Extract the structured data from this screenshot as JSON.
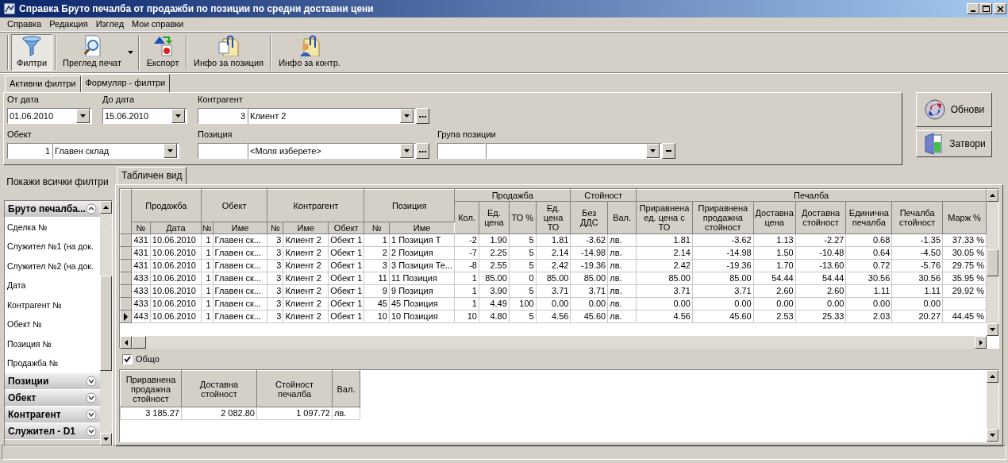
{
  "window": {
    "title": "Справка Бруто печалба от продажби по позиции по средни доставни цени"
  },
  "menu": [
    "Справка",
    "Редакция",
    "Изглед",
    "Мои справки"
  ],
  "toolbar": [
    {
      "label": "Филтри",
      "pressed": true,
      "has_dropdown": false
    },
    {
      "label": "Преглед печат",
      "pressed": false,
      "has_dropdown": true
    },
    {
      "label": "Експорт",
      "pressed": false,
      "has_dropdown": false
    },
    {
      "label": "Инфо за позиция",
      "pressed": false,
      "has_dropdown": false
    },
    {
      "label": "Инфо за контр.",
      "pressed": false,
      "has_dropdown": false
    }
  ],
  "filter_tabs": [
    {
      "label": "Активни филтри",
      "selected": false
    },
    {
      "label": "Формуляр - филтри",
      "selected": true
    }
  ],
  "filter_rows": [
    [
      {
        "kind": "date",
        "label": "От дата",
        "value": "01.06.2010"
      },
      {
        "kind": "date",
        "label": "До дата",
        "value": "15.06.2010"
      },
      {
        "kind": "lookup",
        "label": "Контрагент",
        "code": "3",
        "value": "Клиент 2"
      }
    ],
    [
      {
        "kind": "list",
        "label": "Обект",
        "code": "1",
        "value": "Главен склад"
      },
      {
        "kind": "lookup",
        "label": "Позиция",
        "value": "<Моля изберете>"
      },
      {
        "kind": "group",
        "label": "Група позиции"
      }
    ]
  ],
  "side_buttons": [
    "Обнови",
    "Затвори"
  ],
  "sidebar": {
    "show_all": "Покажи всички филтри",
    "groups": [
      {
        "title": "Бруто печалба...",
        "expanded": true,
        "items": [
          "Сделка №",
          "Служител №1 (на док.",
          "Служител №2 (на док.",
          "Дата",
          "Контрагент №",
          "Обект №",
          "Позиция №",
          "Продажба №"
        ]
      },
      {
        "title": "Позиции",
        "expanded": false
      },
      {
        "title": "Обект",
        "expanded": false
      },
      {
        "title": "Контрагент",
        "expanded": false
      },
      {
        "title": "Служител - D1",
        "expanded": false
      }
    ]
  },
  "grid": {
    "tab": "Табличен вид",
    "groups": [
      {
        "title": "Продажба",
        "kind": "spanning",
        "columns": [
          "№",
          "Дата"
        ]
      },
      {
        "title": "Обект",
        "kind": "spanning",
        "columns": [
          "№",
          "Име"
        ]
      },
      {
        "title": "Контрагент",
        "kind": "spanning",
        "columns": [
          "№",
          "Име",
          "Обект"
        ]
      },
      {
        "title": "Позиция",
        "kind": "spanning",
        "columns": [
          "№",
          "Име"
        ]
      },
      {
        "title": "Продажба",
        "kind": "banner",
        "columns": [
          "Кол.",
          "Ед. цена",
          "ТО %",
          "Ед. цена ТО"
        ]
      },
      {
        "title": "Стойност",
        "kind": "banner",
        "columns": [
          "Без ДДС",
          "Вал."
        ]
      },
      {
        "title": "Печалба",
        "kind": "banner",
        "columns": [
          "Приравнена ед. цена с ТО",
          "Приравнена продажна стойност",
          "Доставна цена",
          "Доставна стойност",
          "Единична печалба",
          "Печалба стойност",
          "Марж %"
        ]
      }
    ],
    "rows": [
      {
        "current": false,
        "cells": [
          "431",
          "10.06.2010",
          "1",
          "Главен ск...",
          "3",
          "Клиент 2",
          "Обект 1",
          "1",
          "1 Позиция Т",
          "-2",
          "1.90",
          "5",
          "1.81",
          "-3.62",
          "лв.",
          "1.81",
          "-3.62",
          "1.13",
          "-2.27",
          "0.68",
          "-1.35",
          "37.33 %"
        ]
      },
      {
        "current": false,
        "cells": [
          "431",
          "10.06.2010",
          "1",
          "Главен ск...",
          "3",
          "Клиент 2",
          "Обект 1",
          "2",
          "2 Позиция",
          "-7",
          "2.25",
          "5",
          "2.14",
          "-14.98",
          "лв.",
          "2.14",
          "-14.98",
          "1.50",
          "-10.48",
          "0.64",
          "-4.50",
          "30.05 %"
        ]
      },
      {
        "current": false,
        "cells": [
          "431",
          "10.06.2010",
          "1",
          "Главен ск...",
          "3",
          "Клиент 2",
          "Обект 1",
          "3",
          "3 Позиция Те...",
          "-8",
          "2.55",
          "5",
          "2.42",
          "-19.36",
          "лв.",
          "2.42",
          "-19.36",
          "1.70",
          "-13.60",
          "0.72",
          "-5.76",
          "29.75 %"
        ]
      },
      {
        "current": false,
        "cells": [
          "433",
          "10.06.2010",
          "1",
          "Главен ск...",
          "3",
          "Клиент 2",
          "Обект 1",
          "11",
          "11 Позиция",
          "1",
          "85.00",
          "0",
          "85.00",
          "85.00",
          "лв.",
          "85.00",
          "85.00",
          "54.44",
          "54.44",
          "30.56",
          "30.56",
          "35.95 %"
        ]
      },
      {
        "current": false,
        "cells": [
          "433",
          "10.06.2010",
          "1",
          "Главен ск...",
          "3",
          "Клиент 2",
          "Обект 1",
          "9",
          "9 Позиция",
          "1",
          "3.90",
          "5",
          "3.71",
          "3.71",
          "лв.",
          "3.71",
          "3.71",
          "2.60",
          "2.60",
          "1.11",
          "1.11",
          "29.92 %"
        ]
      },
      {
        "current": false,
        "cells": [
          "433",
          "10.06.2010",
          "1",
          "Главен ск...",
          "3",
          "Клиент 2",
          "Обект 1",
          "45",
          "45 Позиция",
          "1",
          "4.49",
          "100",
          "0.00",
          "0.00",
          "лв.",
          "0.00",
          "0.00",
          "0.00",
          "0.00",
          "0.00",
          "0.00",
          null
        ]
      },
      {
        "current": true,
        "cells": [
          "443",
          "10.06.2010",
          "1",
          "Главен ск...",
          "3",
          "Клиент 2",
          "Обект 1",
          "10",
          "10 Позиция",
          "10",
          "4.80",
          "5",
          "4.56",
          "45.60",
          "лв.",
          "4.56",
          "45.60",
          "2.53",
          "25.33",
          "2.03",
          "20.27",
          "44.45 %"
        ]
      }
    ]
  },
  "totals": {
    "checked": true,
    "label": "Общо",
    "columns": [
      "Приравнена продажна стойност",
      "Доставна стойност",
      "Стойност печалба",
      "Вал."
    ],
    "rows": [
      [
        "3 185.27",
        "2 082.80",
        "1 097.72",
        "лв."
      ]
    ]
  }
}
